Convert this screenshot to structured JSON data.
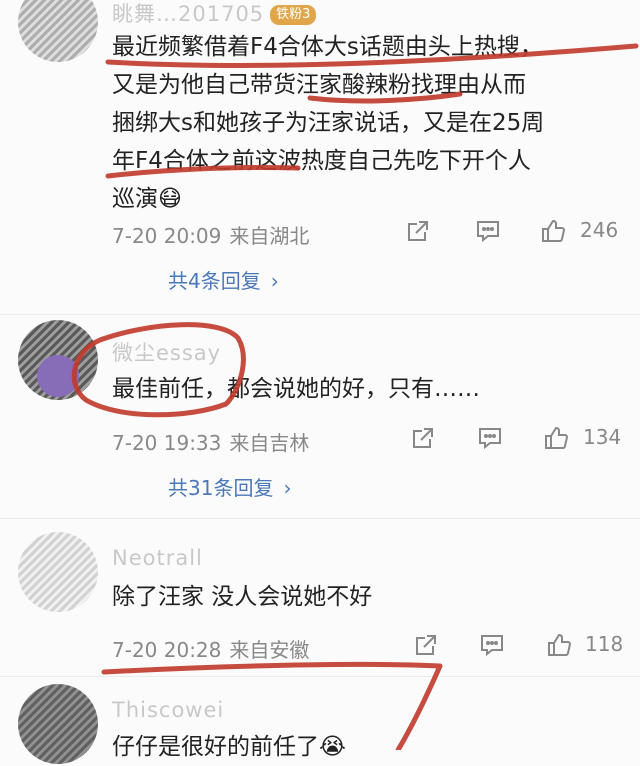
{
  "comments": [
    {
      "username": "眺舞…201705",
      "badge": "铁粉3",
      "text_lines": [
        "最近频繁借着F4合体大s话题由头上热搜，",
        "又是为他自己带货汪家酸辣粉找理由从而",
        "捆绑大s和她孩子为汪家说话，又是在25周",
        "年F4合体之前这波热度自己先吃下开个人",
        "巡演😷"
      ],
      "time": "7-20 20:09",
      "location": "来自湖北",
      "likes": "246",
      "replies_label": "共4条回复",
      "chevron": "›"
    },
    {
      "username": "微尘essay",
      "text": "最佳前任，都会说她的好，只有……",
      "time": "7-20 19:33",
      "location": "来自吉林",
      "likes": "134",
      "replies_label": "共31条回复",
      "chevron": "›"
    },
    {
      "username": "Neotrall",
      "text": "除了汪家 没人会说她不好",
      "time": "7-20 20:28",
      "location": "来自安徽",
      "likes": "118"
    },
    {
      "username": "Thiscowei",
      "text": "仔仔是很好的前任了😭"
    }
  ],
  "icons": [
    "share-icon",
    "comment-icon",
    "like-icon"
  ],
  "colors": {
    "annotation": "#c0392b",
    "reply_link": "#4a78b8",
    "meta": "#888888"
  }
}
